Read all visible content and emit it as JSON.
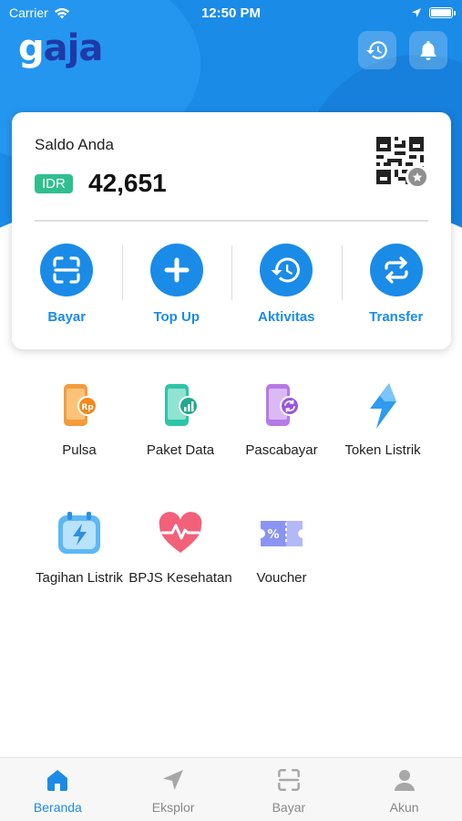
{
  "status_bar": {
    "carrier": "Carrier",
    "time": "12:50 PM"
  },
  "header": {
    "logo_g": "g",
    "logo_aja": "aja"
  },
  "balance": {
    "label": "Saldo Anda",
    "currency": "IDR",
    "amount": "42,651"
  },
  "actions": [
    {
      "label": "Bayar",
      "icon": "scan-icon"
    },
    {
      "label": "Top Up",
      "icon": "plus-icon"
    },
    {
      "label": "Aktivitas",
      "icon": "history-icon"
    },
    {
      "label": "Transfer",
      "icon": "transfer-icon"
    }
  ],
  "services": [
    {
      "label": "Pulsa",
      "icon": "phone-rp-icon"
    },
    {
      "label": "Paket Data",
      "icon": "phone-data-icon"
    },
    {
      "label": "Pascabayar",
      "icon": "phone-postpaid-icon"
    },
    {
      "label": "Token Listrik",
      "icon": "lightning-icon"
    },
    {
      "label": "Tagihan Listrik",
      "icon": "electric-bill-icon"
    },
    {
      "label": "BPJS Kesehatan",
      "icon": "heartbeat-icon"
    },
    {
      "label": "Voucher",
      "icon": "voucher-icon"
    }
  ],
  "bottom_nav": [
    {
      "label": "Beranda",
      "icon": "home-icon",
      "active": true
    },
    {
      "label": "Eksplor",
      "icon": "navigate-icon",
      "active": false
    },
    {
      "label": "Bayar",
      "icon": "scan-icon",
      "active": false
    },
    {
      "label": "Akun",
      "icon": "user-icon",
      "active": false
    }
  ],
  "colors": {
    "primary": "#1b8be8",
    "accent_green": "#2fbf8f",
    "logo_dark": "#1e3aa8"
  }
}
